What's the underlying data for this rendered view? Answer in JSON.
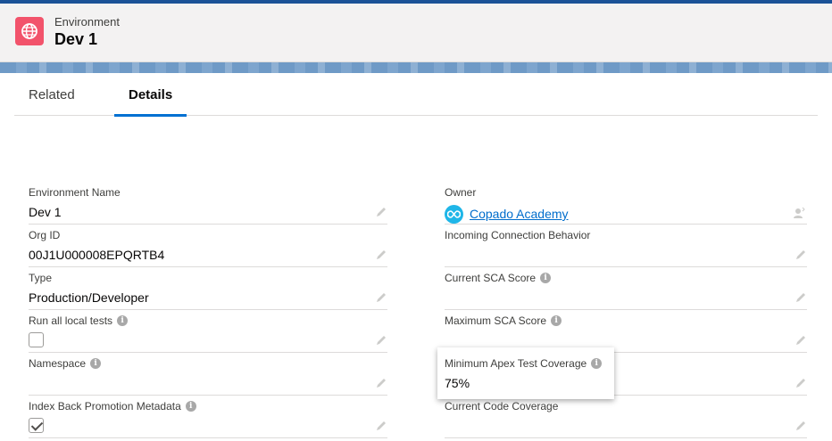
{
  "header": {
    "object_label": "Environment",
    "record_title": "Dev 1",
    "icon": "globe-icon"
  },
  "tabs": [
    {
      "label": "Related",
      "active": false
    },
    {
      "label": "Details",
      "active": true
    }
  ],
  "fields_left": [
    {
      "label": "Environment Name",
      "value": "Dev 1",
      "info": false
    },
    {
      "label": "Org ID",
      "value": "00J1U000008EPQRTB4",
      "info": false
    },
    {
      "label": "Type",
      "value": "Production/Developer",
      "info": false
    },
    {
      "label": "Run all local tests",
      "checkbox": false,
      "info": true
    },
    {
      "label": "Namespace",
      "value": "",
      "info": true
    },
    {
      "label": "Index Back Promotion Metadata",
      "checkbox": true,
      "info": true
    }
  ],
  "fields_right": [
    {
      "label": "Owner",
      "value": "Copado Academy",
      "info": false
    },
    {
      "label": "Incoming Connection Behavior",
      "value": "",
      "info": false
    },
    {
      "label": "Current SCA Score",
      "value": "",
      "info": true
    },
    {
      "label": "Maximum SCA Score",
      "value": "",
      "info": true
    },
    {
      "label": "Minimum Apex Test Coverage",
      "value": "75%",
      "info": true
    },
    {
      "label": "Current Code Coverage",
      "value": "",
      "info": false
    }
  ],
  "colors": {
    "accent": "#0070d2",
    "object_icon": "#f2536b",
    "owner_avatar": "#1fb6e8",
    "link": "#006dcc"
  }
}
